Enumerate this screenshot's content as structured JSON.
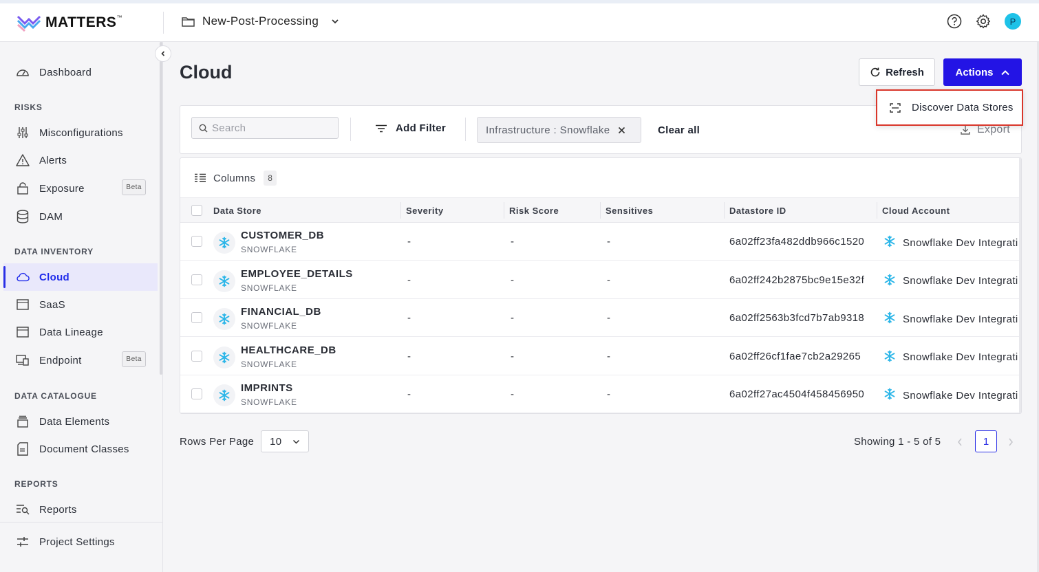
{
  "app": {
    "logo_text": "MATTERS",
    "logo_tm": "™",
    "project": "New-Post-Processing",
    "avatar_letter": "P"
  },
  "sidebar": {
    "dashboard": "Dashboard",
    "sections": {
      "risks": "RISKS",
      "data_inventory": "DATA INVENTORY",
      "data_catalogue": "DATA CATALOGUE",
      "reports": "REPORTS"
    },
    "risks": [
      {
        "label": "Misconfigurations",
        "icon": "sliders-icon"
      },
      {
        "label": "Alerts",
        "icon": "warning-icon"
      },
      {
        "label": "Exposure",
        "icon": "lock-icon",
        "badge": "Beta"
      },
      {
        "label": "DAM",
        "icon": "database-icon"
      }
    ],
    "inventory": [
      {
        "label": "Cloud",
        "icon": "cloud-icon",
        "active": true
      },
      {
        "label": "SaaS",
        "icon": "window-icon"
      },
      {
        "label": "Data Lineage",
        "icon": "window-icon"
      },
      {
        "label": "Endpoint",
        "icon": "devices-icon",
        "badge": "Beta"
      }
    ],
    "catalogue": [
      {
        "label": "Data Elements",
        "icon": "stack-icon"
      },
      {
        "label": "Document Classes",
        "icon": "document-icon"
      }
    ],
    "reports": [
      {
        "label": "Reports",
        "icon": "report-search-icon"
      }
    ],
    "project_settings": "Project Settings"
  },
  "main": {
    "title": "Cloud",
    "refresh_label": "Refresh",
    "actions_label": "Actions",
    "dropdown_item": "Discover Data Stores",
    "search_placeholder": "Search",
    "add_filter_label": "Add Filter",
    "filter_chip": "Infrastructure : Snowflake",
    "clear_all": "Clear all",
    "export_label": "Export",
    "columns_label": "Columns",
    "columns_count": "8",
    "headers": [
      "Data Store",
      "Severity",
      "Risk Score",
      "Sensitives",
      "Datastore ID",
      "Cloud Account"
    ],
    "rows": [
      {
        "name": "CUSTOMER_DB",
        "type": "SNOWFLAKE",
        "severity": "-",
        "risk": "-",
        "sensitives": "-",
        "id": "6a02ff23fa482ddb966c1520",
        "account": "Snowflake Dev Integrati"
      },
      {
        "name": "EMPLOYEE_DETAILS",
        "type": "SNOWFLAKE",
        "severity": "-",
        "risk": "-",
        "sensitives": "-",
        "id": "6a02ff242b2875bc9e15e32f",
        "account": "Snowflake Dev Integrati"
      },
      {
        "name": "FINANCIAL_DB",
        "type": "SNOWFLAKE",
        "severity": "-",
        "risk": "-",
        "sensitives": "-",
        "id": "6a02ff2563b3fcd7b7ab9318",
        "account": "Snowflake Dev Integrati"
      },
      {
        "name": "HEALTHCARE_DB",
        "type": "SNOWFLAKE",
        "severity": "-",
        "risk": "-",
        "sensitives": "-",
        "id": "6a02ff26cf1fae7cb2a29265",
        "account": "Snowflake Dev Integrati"
      },
      {
        "name": "IMPRINTS",
        "type": "SNOWFLAKE",
        "severity": "-",
        "risk": "-",
        "sensitives": "-",
        "id": "6a02ff27ac4504f458456950",
        "account": "Snowflake Dev Integrati"
      }
    ],
    "rows_per_page_label": "Rows Per Page",
    "rows_per_page_value": "10",
    "showing": "Showing 1 - 5 of 5",
    "current_page": "1"
  },
  "colors": {
    "primary": "#2314e5",
    "highlight_border": "#d9362a",
    "snowflake": "#29b5e8",
    "avatar": "#1ec2e8"
  }
}
